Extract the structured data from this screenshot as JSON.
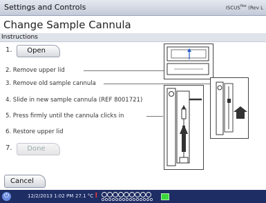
{
  "titlebar": {
    "title": "Settings and Controls",
    "brand": "ISCUS",
    "brand_sup": "flex",
    "rev": "(Rev L"
  },
  "page": {
    "heading": "Change Sample Cannula",
    "section": "Instructions"
  },
  "steps": [
    {
      "num": "1.",
      "button": "Open"
    },
    {
      "text": "2. Remove upper lid"
    },
    {
      "text": "3. Remove old sample cannula"
    },
    {
      "text": "4. Slide in new sample cannula (REF 8001721)"
    },
    {
      "text": "5. Press firmly until the cannula clicks in"
    },
    {
      "text": "6. Restore upper lid"
    },
    {
      "num": "7.",
      "button": "Done"
    }
  ],
  "footer": {
    "cancel": "Cancel"
  },
  "status": {
    "date": "12/2/2013 1:02 PM",
    "temp": "27.1 °C",
    "alert": "!"
  },
  "colors": {
    "status_bg": "#1e2d63",
    "alert": "#ff3b3b",
    "battery": "#3ad63a",
    "arrow": "#333333"
  }
}
